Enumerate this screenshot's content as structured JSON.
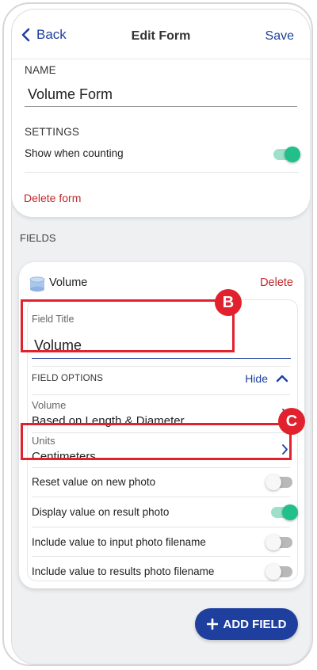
{
  "nav": {
    "back_label": "Back",
    "title": "Edit Form",
    "save_label": "Save"
  },
  "form": {
    "name_section_label": "NAME",
    "name_value": "Volume Form",
    "settings_label": "SETTINGS",
    "show_when_counting_label": "Show when counting",
    "show_when_counting_on": true,
    "delete_form_label": "Delete form"
  },
  "fields_section": {
    "label": "FIELDS"
  },
  "field": {
    "icon": "cylinder-icon",
    "title": "Volume",
    "delete_label": "Delete",
    "field_title_label": "Field Title",
    "field_title_value": "Volume",
    "field_options_label": "FIELD OPTIONS",
    "hide_label": "Hide",
    "options": [
      {
        "label": "Volume",
        "value": "Based on Length & Diameter"
      },
      {
        "label": "Units",
        "value": "Centimeters"
      }
    ],
    "toggles": [
      {
        "label": "Reset value on new photo",
        "on": false
      },
      {
        "label": "Display value on result photo",
        "on": true
      },
      {
        "label": "Include value to input photo filename",
        "on": false
      },
      {
        "label": "Include value to results photo filename",
        "on": false
      }
    ]
  },
  "add_field_label": "ADD FIELD",
  "callouts": [
    {
      "letter": "B"
    },
    {
      "letter": "C"
    }
  ],
  "colors": {
    "accent": "#1f3f9e",
    "danger": "#c0282d",
    "toggle_on": "#21c08b",
    "callout": "#e1222e"
  }
}
